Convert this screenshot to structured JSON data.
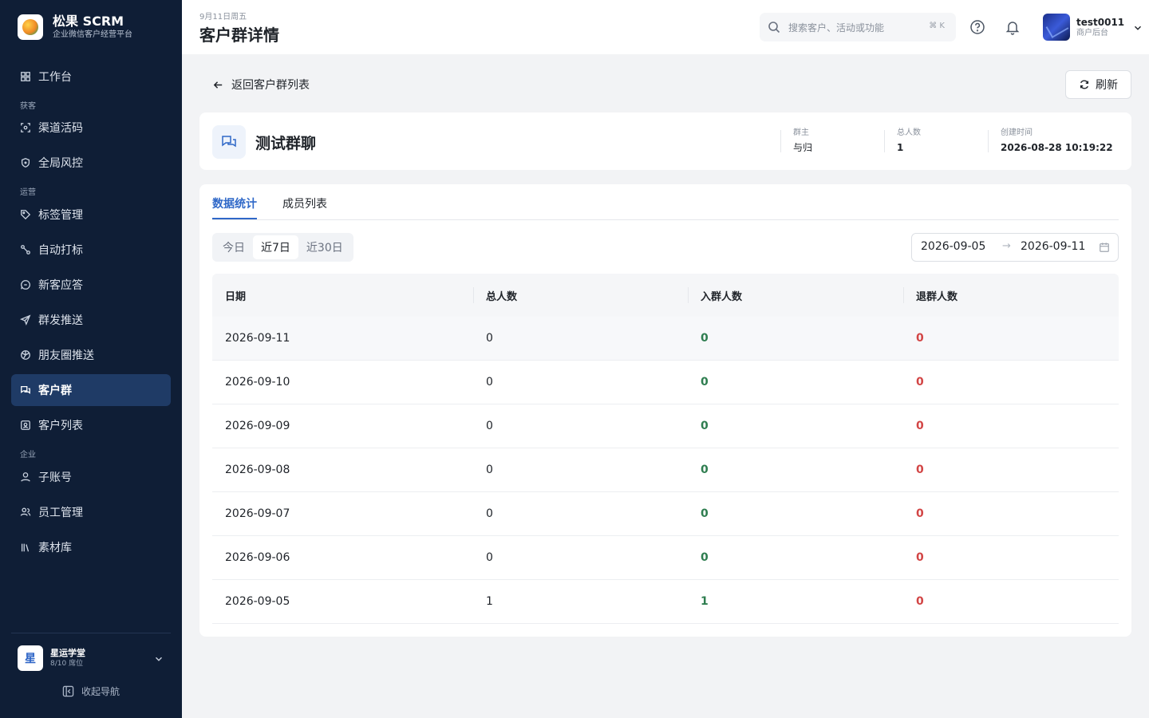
{
  "brand": {
    "title": "松果 SCRM",
    "subtitle": "企业微信客户经营平台"
  },
  "sidebar": {
    "items": [
      {
        "label": "工作台",
        "icon": "dashboard-icon"
      },
      {
        "label": "渠道活码",
        "icon": "qrcode-icon"
      },
      {
        "label": "全局风控",
        "icon": "shield-icon"
      },
      {
        "label": "标签管理",
        "icon": "tag-icon"
      },
      {
        "label": "自动打标",
        "icon": "auto-tag-icon"
      },
      {
        "label": "新客应答",
        "icon": "reply-icon"
      },
      {
        "label": "群发推送",
        "icon": "send-icon"
      },
      {
        "label": "朋友圈推送",
        "icon": "moments-icon"
      },
      {
        "label": "客户群",
        "icon": "chat-group-icon",
        "active": true
      },
      {
        "label": "客户列表",
        "icon": "contacts-icon"
      },
      {
        "label": "子账号",
        "icon": "user-icon"
      },
      {
        "label": "员工管理",
        "icon": "staff-icon"
      },
      {
        "label": "素材库",
        "icon": "library-icon"
      }
    ],
    "sections": {
      "acquire": "获客",
      "operate": "运营",
      "enterprise": "企业"
    },
    "org": {
      "avatar": "星",
      "name": "星运学堂",
      "seats": "8/10 席位"
    },
    "collapse_label": "收起导航"
  },
  "header": {
    "date": "9月11日周五",
    "title": "客户群详情",
    "search_placeholder": "搜索客户、活动或功能",
    "search_shortcut": "⌘ K",
    "user": {
      "name": "test0011",
      "role": "商户后台"
    }
  },
  "back_label": "返回客户群列表",
  "refresh_label": "刷新",
  "group": {
    "name": "测试群聊",
    "owner_label": "群主",
    "owner": "与归",
    "total_label": "总人数",
    "total": "1",
    "created_label": "创建时间",
    "created": "2026-08-28 10:19:22"
  },
  "tabs": [
    "数据统计",
    "成员列表"
  ],
  "ranges": [
    "今日",
    "近7日",
    "近30日"
  ],
  "active_range": "近7日",
  "date_range": {
    "start": "2026-09-05",
    "separator": "→",
    "end": "2026-09-11"
  },
  "table": {
    "columns": [
      "日期",
      "总人数",
      "入群人数",
      "退群人数"
    ],
    "rows": [
      [
        "2026-09-11",
        "0",
        "0",
        "0"
      ],
      [
        "2026-09-10",
        "0",
        "0",
        "0"
      ],
      [
        "2026-09-09",
        "0",
        "0",
        "0"
      ],
      [
        "2026-09-08",
        "0",
        "0",
        "0"
      ],
      [
        "2026-09-07",
        "0",
        "0",
        "0"
      ],
      [
        "2026-09-06",
        "0",
        "0",
        "0"
      ],
      [
        "2026-09-05",
        "1",
        "1",
        "0"
      ]
    ]
  },
  "colors": {
    "sidebar_bg": "#0f1e36",
    "accent": "#2f68c8",
    "join": "#2e7d4f",
    "leave": "#d24545"
  }
}
